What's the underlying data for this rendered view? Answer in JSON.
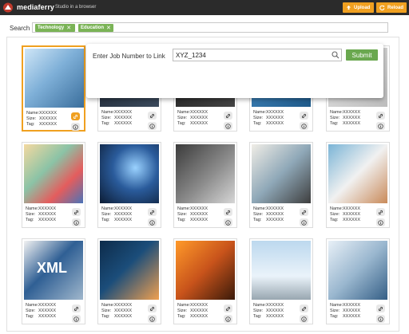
{
  "app": {
    "brand": "mediaferry",
    "tagline": "Studio in a browser",
    "upload_label": "Upload",
    "reload_label": "Reload"
  },
  "search": {
    "label": "Search",
    "chips": [
      {
        "label": "Technology"
      },
      {
        "label": "Education"
      }
    ]
  },
  "popup": {
    "label": "Enter Job Number to Link",
    "input_value": "XYZ_1234",
    "submit_label": "Submit"
  },
  "card_meta": {
    "name_label": "Name:",
    "size_label": "Size:",
    "tag_label": "Tag:",
    "placeholder": "XXXXXX"
  },
  "colors": {
    "accent_orange": "#f0a020",
    "chip_green": "#7ab356",
    "submit_green": "#6aa84f",
    "topbar": "#2b2b2b"
  },
  "cards": [
    {
      "name": "XXXXXX",
      "size": "XXXXXX",
      "tag": "XXXXXX",
      "selected": true
    },
    {
      "name": "XXXXXX",
      "size": "XXXXXX",
      "tag": "XXXXXX"
    },
    {
      "name": "XXXXXX",
      "size": "XXXXXX",
      "tag": "XXXXXX"
    },
    {
      "name": "XXXXXX",
      "size": "XXXXXX",
      "tag": "XXXXXX"
    },
    {
      "name": "XXXXXX",
      "size": "XXXXXX",
      "tag": "XXXXXX"
    },
    {
      "name": "XXXXXX",
      "size": "XXXXXX",
      "tag": "XXXXXX"
    },
    {
      "name": "XXXXXX",
      "size": "XXXXXX",
      "tag": "XXXXXX"
    },
    {
      "name": "XXXXXX",
      "size": "XXXXXX",
      "tag": "XXXXXX"
    },
    {
      "name": "XXXXXX",
      "size": "XXXXXX",
      "tag": "XXXXXX"
    },
    {
      "name": "XXXXXX",
      "size": "XXXXXX",
      "tag": "XXXXXX"
    },
    {
      "name": "XXXXXX",
      "size": "XXXXXX",
      "tag": "XXXXXX"
    },
    {
      "name": "XXXXXX",
      "size": "XXXXXX",
      "tag": "XXXXXX"
    },
    {
      "name": "XXXXXX",
      "size": "XXXXXX",
      "tag": "XXXXXX"
    },
    {
      "name": "XXXXXX",
      "size": "XXXXXX",
      "tag": "XXXXXX"
    },
    {
      "name": "XXXXXX",
      "size": "XXXXXX",
      "tag": "XXXXXX"
    }
  ]
}
